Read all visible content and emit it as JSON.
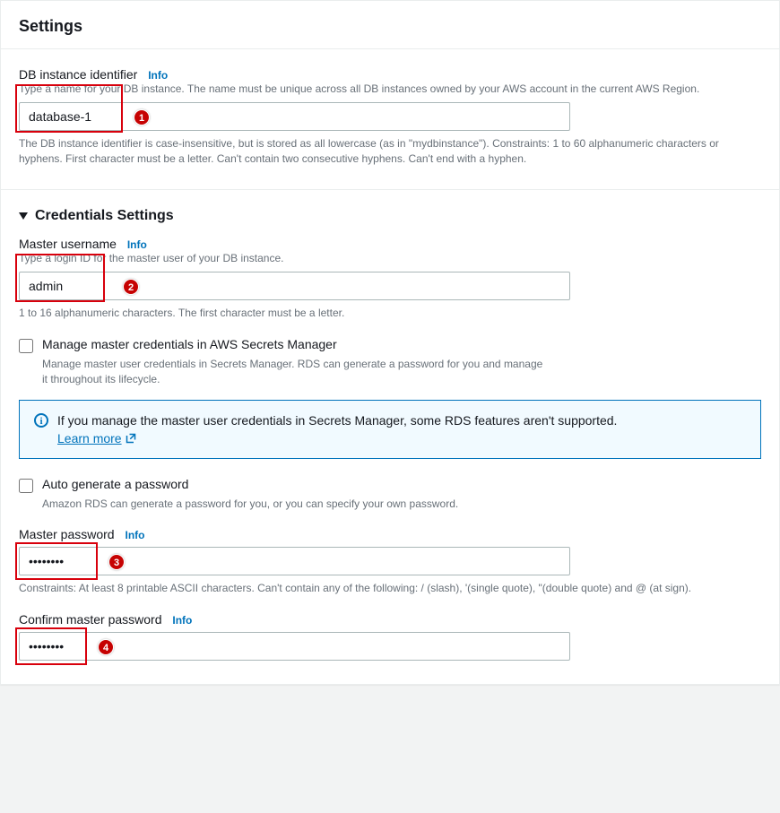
{
  "panel_title": "Settings",
  "db_identifier": {
    "label": "DB instance identifier",
    "info": "Info",
    "desc": "Type a name for your DB instance. The name must be unique across all DB instances owned by your AWS account in the current AWS Region.",
    "value": "database-1",
    "hint": "The DB instance identifier is case-insensitive, but is stored as all lowercase (as in \"mydbinstance\"). Constraints: 1 to 60 alphanumeric characters or hyphens. First character must be a letter. Can't contain two consecutive hyphens. Can't end with a hyphen."
  },
  "credentials": {
    "header": "Credentials Settings",
    "master_username": {
      "label": "Master username",
      "info": "Info",
      "desc": "Type a login ID for the master user of your DB instance.",
      "value": "admin",
      "hint": "1 to 16 alphanumeric characters. The first character must be a letter."
    },
    "secrets_manager": {
      "label": "Manage master credentials in AWS Secrets Manager",
      "desc": "Manage master user credentials in Secrets Manager. RDS can generate a password for you and manage it throughout its lifecycle."
    },
    "info_box": {
      "text": "If you manage the master user credentials in Secrets Manager, some RDS features aren't supported.",
      "learn_more": "Learn more"
    },
    "auto_generate": {
      "label": "Auto generate a password",
      "desc": "Amazon RDS can generate a password for you, or you can specify your own password."
    },
    "master_password": {
      "label": "Master password",
      "info": "Info",
      "value": "••••••••",
      "hint": "Constraints: At least 8 printable ASCII characters. Can't contain any of the following: / (slash), '(single quote), \"(double quote) and @ (at sign)."
    },
    "confirm_password": {
      "label": "Confirm master password",
      "info": "Info",
      "value": "••••••••"
    }
  },
  "badge": {
    "1": "1",
    "2": "2",
    "3": "3",
    "4": "4"
  }
}
